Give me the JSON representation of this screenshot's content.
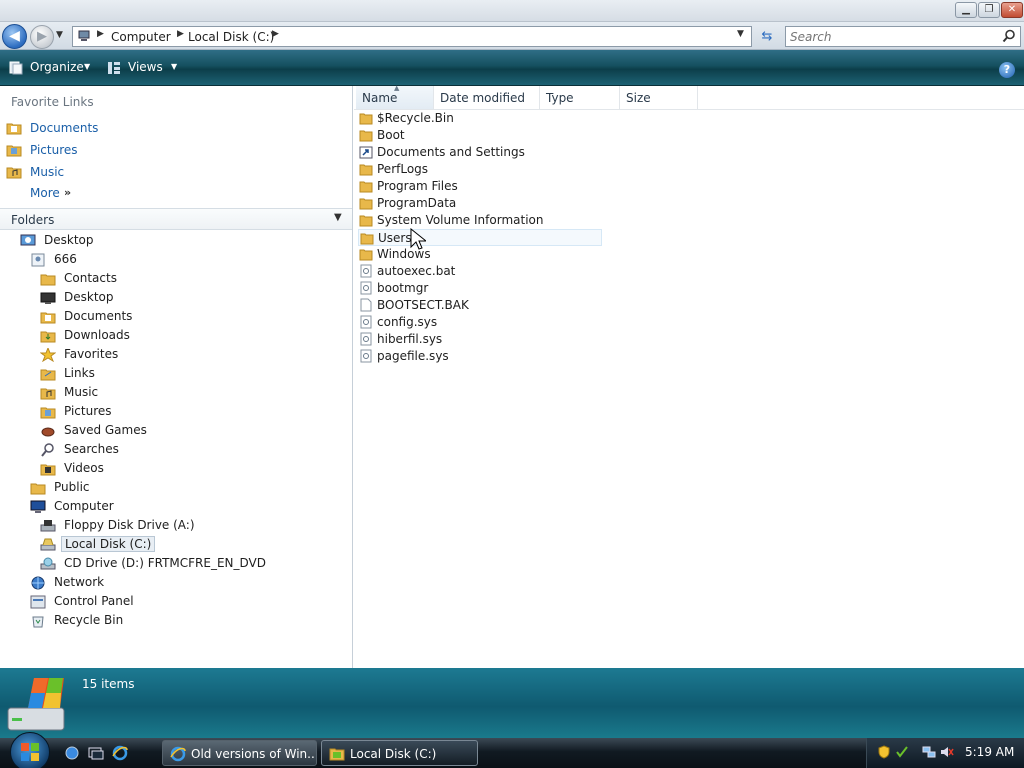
{
  "window": {
    "minimize_glyph": "▁",
    "maximize_glyph": "❐",
    "close_glyph": "✕"
  },
  "address": {
    "breadcrumbs": [
      "Computer",
      "Local Disk (C:)"
    ],
    "search_placeholder": "Search"
  },
  "toolbar": {
    "organize_label": "Organize",
    "views_label": "Views",
    "help_label": "?"
  },
  "favorites": {
    "title": "Favorite Links",
    "items": [
      "Documents",
      "Pictures",
      "Music"
    ],
    "more_label": "More",
    "more_chevron": "»"
  },
  "folders": {
    "title": "Folders",
    "tree": [
      {
        "label": "Desktop",
        "icon": "desktop-icon"
      },
      {
        "label": "666",
        "icon": "user-folder-icon"
      },
      {
        "label": "Contacts",
        "icon": "contacts-icon"
      },
      {
        "label": "Desktop",
        "icon": "desktop-folder-icon"
      },
      {
        "label": "Documents",
        "icon": "documents-folder-icon"
      },
      {
        "label": "Downloads",
        "icon": "downloads-folder-icon"
      },
      {
        "label": "Favorites",
        "icon": "favorites-star-icon"
      },
      {
        "label": "Links",
        "icon": "links-folder-icon"
      },
      {
        "label": "Music",
        "icon": "music-folder-icon"
      },
      {
        "label": "Pictures",
        "icon": "pictures-folder-icon"
      },
      {
        "label": "Saved Games",
        "icon": "saved-games-icon"
      },
      {
        "label": "Searches",
        "icon": "searches-icon"
      },
      {
        "label": "Videos",
        "icon": "videos-folder-icon"
      },
      {
        "label": "Public",
        "icon": "folder-icon"
      },
      {
        "label": "Computer",
        "icon": "computer-icon"
      },
      {
        "label": "Floppy Disk Drive (A:)",
        "icon": "floppy-drive-icon"
      },
      {
        "label": "Local Disk (C:)",
        "icon": "hard-drive-icon"
      },
      {
        "label": "CD Drive (D:) FRTMCFRE_EN_DVD",
        "icon": "cd-drive-icon"
      },
      {
        "label": "Network",
        "icon": "network-icon"
      },
      {
        "label": "Control Panel",
        "icon": "control-panel-icon"
      },
      {
        "label": "Recycle Bin",
        "icon": "recycle-bin-icon"
      }
    ]
  },
  "columns": {
    "name": "Name",
    "date_modified": "Date modified",
    "type": "Type",
    "size": "Size"
  },
  "files": [
    {
      "name": "$Recycle.Bin",
      "icon": "folder-icon"
    },
    {
      "name": "Boot",
      "icon": "folder-icon"
    },
    {
      "name": "Documents and Settings",
      "icon": "shortcut-folder-icon"
    },
    {
      "name": "PerfLogs",
      "icon": "folder-icon"
    },
    {
      "name": "Program Files",
      "icon": "folder-icon"
    },
    {
      "name": "ProgramData",
      "icon": "folder-icon"
    },
    {
      "name": "System Volume Information",
      "icon": "folder-icon"
    },
    {
      "name": "Users",
      "icon": "folder-icon"
    },
    {
      "name": "Windows",
      "icon": "folder-icon"
    },
    {
      "name": "autoexec.bat",
      "icon": "system-file-icon"
    },
    {
      "name": "bootmgr",
      "icon": "system-file-icon"
    },
    {
      "name": "BOOTSECT.BAK",
      "icon": "blank-file-icon"
    },
    {
      "name": "config.sys",
      "icon": "system-file-icon"
    },
    {
      "name": "hiberfil.sys",
      "icon": "system-file-icon"
    },
    {
      "name": "pagefile.sys",
      "icon": "system-file-icon"
    }
  ],
  "status": {
    "text": "15 items"
  },
  "taskbar": {
    "tasks": [
      {
        "label": "Old versions of Win...",
        "icon": "internet-explorer-icon"
      },
      {
        "label": "Local Disk (C:)",
        "icon": "explorer-folder-icon"
      }
    ],
    "clock": "5:19 AM"
  },
  "colors": {
    "toolbar": "#15505f",
    "link": "#1a5fa8",
    "folder": "#e8b84a",
    "status_bar": "#0f5a70",
    "taskbar": "#111a22"
  }
}
